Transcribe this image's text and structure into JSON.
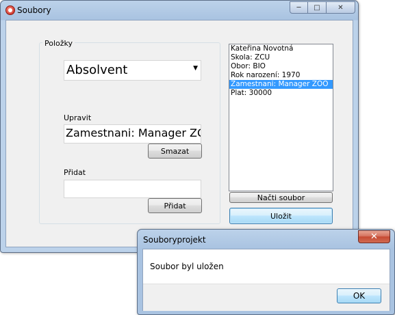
{
  "main_window": {
    "title": "Soubory",
    "caption_buttons": {
      "minimize": "─",
      "maximize": "□",
      "close": "✕"
    },
    "group": {
      "label": "Položky",
      "combo_value": "Absolvent",
      "edit_label": "Upravit",
      "edit_value": "Zamestnani: Manager ZOO",
      "delete_button": "Smazat",
      "add_label": "Přidat",
      "add_value": "",
      "add_button": "Přidat"
    },
    "list": {
      "items": [
        "Kateřina Novotná",
        "Skola: ZCU",
        "Obor: BIO",
        "Rok narození: 1970",
        "Zamestnani: Manager ZOO",
        "Plat: 30000"
      ],
      "selected_index": 4
    },
    "load_button": "Načti soubor",
    "save_button": "Uložit"
  },
  "dialog": {
    "title": "Souboryprojekt",
    "message": "Soubor byl uložen",
    "ok_button": "OK",
    "close_glyph": "✕"
  }
}
